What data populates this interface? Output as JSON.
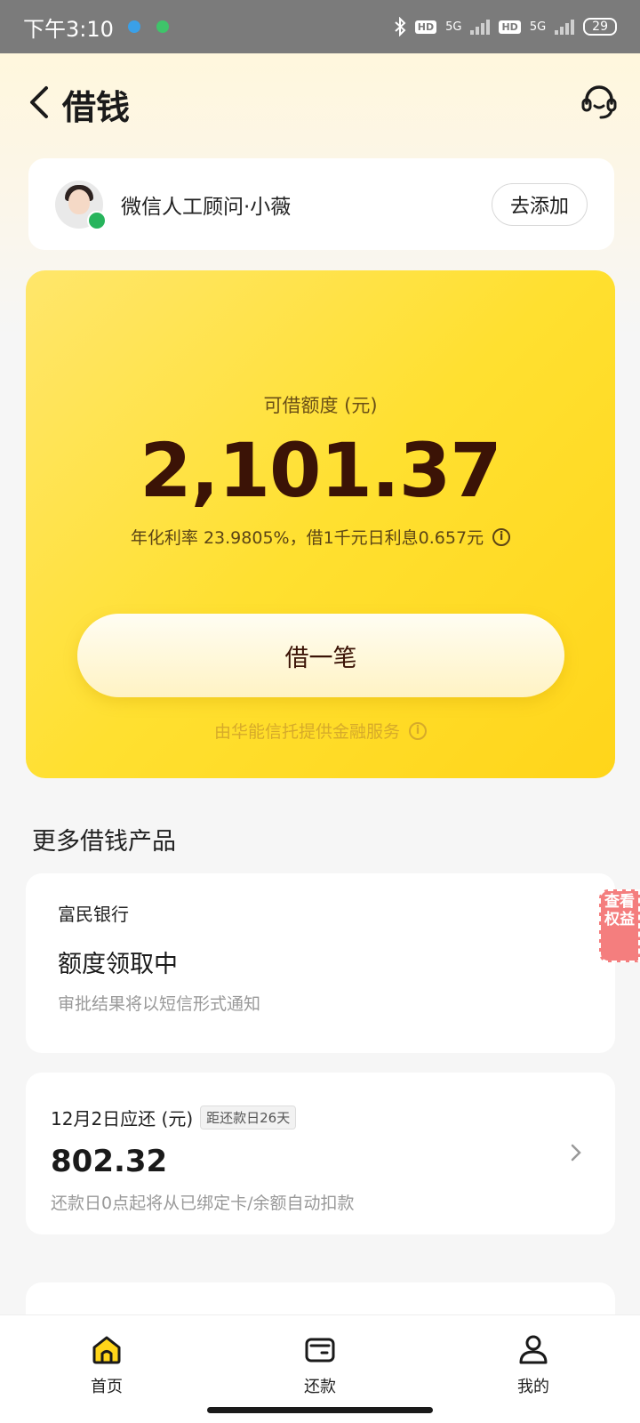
{
  "status_bar": {
    "time": "下午3:10",
    "hd1": "HD",
    "net1": "5G",
    "hd2": "HD",
    "net2": "5G",
    "battery": "29"
  },
  "nav": {
    "title": "借钱"
  },
  "advisor": {
    "name": "微信人工顾问·小薇",
    "add_label": "去添加"
  },
  "credit": {
    "label": "可借额度 (元)",
    "amount": "2,101.37",
    "rate_text": "年化利率 23.9805%，借1千元日利息0.657元",
    "borrow_label": "借一笔",
    "provider_text": "由华能信托提供金融服务"
  },
  "more": {
    "title": "更多借钱产品",
    "bank_name": "富民银行",
    "bank_status": "额度领取中",
    "bank_note": "审批结果将以短信形式通知",
    "side_tag": "查看权益"
  },
  "repayment": {
    "due_label": "12月2日应还 (元)",
    "days_badge": "距还款日26天",
    "amount": "802.32",
    "note": "还款日0点起将从已绑定卡/余额自动扣款"
  },
  "tabbar": {
    "home": "首页",
    "repay": "还款",
    "mine": "我的"
  },
  "colors": {
    "brand_yellow": "#ffe030",
    "amount_text": "#3b1306",
    "wechat_green": "#27b45c",
    "side_tag": "#f47e7e"
  },
  "icons": [
    "back-icon",
    "headset-icon",
    "wechat-icon",
    "info-icon",
    "chevron-right-icon",
    "home-icon",
    "wallet-icon",
    "user-icon"
  ]
}
